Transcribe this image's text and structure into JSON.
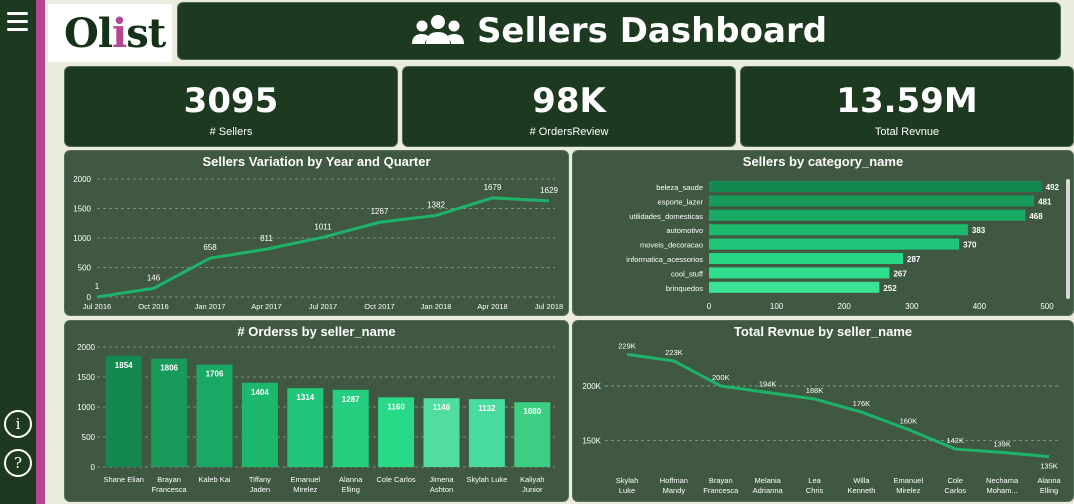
{
  "brand": {
    "logo_prefix": "Ol",
    "logo_highlight": "i",
    "logo_suffix": "st"
  },
  "header": {
    "title": "Sellers Dashboard",
    "icon": "users-icon"
  },
  "sidebar": {
    "menu_icon": "hamburger-icon",
    "info_label": "i",
    "help_label": "?"
  },
  "kpis": [
    {
      "value": "3095",
      "label": "# Sellers"
    },
    {
      "value": "98K",
      "label": "# OrdersReview"
    },
    {
      "value": "13.59M",
      "label": "Total Revnue"
    }
  ],
  "colors": {
    "line": "#1db36a",
    "accent": "#b54690",
    "panel": "#1d3a20"
  },
  "chart_data": [
    {
      "type": "line",
      "title": "Sellers Variation by Year and Quarter",
      "x": [
        "Jul 2016",
        "Oct 2016",
        "Jan 2017",
        "Apr 2017",
        "Jul 2017",
        "Oct 2017",
        "Jan 2018",
        "Apr 2018",
        "Jul 2018"
      ],
      "values": [
        1,
        146,
        658,
        811,
        1011,
        1267,
        1382,
        1679,
        1629
      ],
      "y_ticks": [
        0,
        500,
        1000,
        1500,
        2000
      ],
      "ylim": [
        0,
        2000
      ],
      "grid": true
    },
    {
      "type": "bar",
      "orientation": "horizontal",
      "title": "Sellers by category_name",
      "categories": [
        "beleza_saude",
        "esporte_lazer",
        "utilidades_domesticas",
        "automotivo",
        "moveis_decoracao",
        "informatica_acessorios",
        "cool_stuff",
        "brinquedos"
      ],
      "values": [
        492,
        481,
        468,
        383,
        370,
        287,
        267,
        252
      ],
      "x_ticks": [
        0,
        100,
        200,
        300,
        400,
        500
      ],
      "xlim": [
        0,
        500
      ]
    },
    {
      "type": "bar",
      "title": "# Orderss by seller_name",
      "categories": [
        "Shane Elian",
        "Brayan Francesca",
        "Kaleb Kai",
        "Tiffany Jaden",
        "Emanuel Mirelez",
        "Alanna Elling",
        "Cole Carlos",
        "Jimena Ashton",
        "Skylah Luke",
        "Kaliyah Junior"
      ],
      "values": [
        1854,
        1806,
        1706,
        1404,
        1314,
        1287,
        1160,
        1146,
        1132,
        1080
      ],
      "y_ticks": [
        0,
        500,
        1000,
        1500,
        2000
      ],
      "ylim": [
        0,
        2000
      ]
    },
    {
      "type": "line",
      "title": "Total Revnue by seller_name",
      "x": [
        "Skylah Luke",
        "Hoffman Mandy",
        "Brayan Francesca",
        "Melania Adrianna",
        "Lea Chris",
        "Willa Kenneth",
        "Emanuel Mirelez",
        "Cole Carlos",
        "Nechama Moham...",
        "Alanna Elling"
      ],
      "values": [
        229000,
        223000,
        200000,
        194000,
        188000,
        176000,
        160000,
        142000,
        139000,
        135000
      ],
      "value_labels": [
        "229K",
        "223K",
        "200K",
        "194K",
        "188K",
        "176K",
        "160K",
        "142K",
        "139K",
        "135K"
      ],
      "y_ticks": [
        150000,
        200000
      ],
      "y_tick_labels": [
        "150K",
        "200K"
      ],
      "grid": true
    }
  ]
}
